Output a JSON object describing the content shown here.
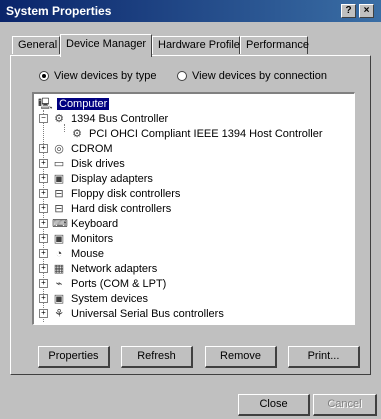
{
  "window": {
    "title": "System Properties",
    "help_button": "?",
    "close_button": "×"
  },
  "tabs": [
    {
      "label": "General"
    },
    {
      "label": "Device Manager"
    },
    {
      "label": "Hardware Profiles"
    },
    {
      "label": "Performance"
    }
  ],
  "view_options": {
    "by_type": "View devices by type",
    "by_connection": "View devices by connection",
    "selected": "by_type"
  },
  "tree": {
    "root": "Computer",
    "items": [
      {
        "label": "1394 Bus Controller",
        "expander": "−",
        "icon": "bus-controller-icon"
      },
      {
        "label": "PCI OHCI Compliant IEEE 1394 Host Controller",
        "expander": "",
        "icon": "bus-controller-icon"
      },
      {
        "label": "CDROM",
        "expander": "+",
        "icon": "cdrom-icon"
      },
      {
        "label": "Disk drives",
        "expander": "+",
        "icon": "disk-drive-icon"
      },
      {
        "label": "Display adapters",
        "expander": "+",
        "icon": "display-adapter-icon"
      },
      {
        "label": "Floppy disk controllers",
        "expander": "+",
        "icon": "floppy-controller-icon"
      },
      {
        "label": "Hard disk controllers",
        "expander": "+",
        "icon": "hard-disk-controller-icon"
      },
      {
        "label": "Keyboard",
        "expander": "+",
        "icon": "keyboard-icon"
      },
      {
        "label": "Monitors",
        "expander": "+",
        "icon": "monitor-icon"
      },
      {
        "label": "Mouse",
        "expander": "+",
        "icon": "mouse-icon"
      },
      {
        "label": "Network adapters",
        "expander": "+",
        "icon": "network-adapter-icon"
      },
      {
        "label": "Ports (COM & LPT)",
        "expander": "+",
        "icon": "port-icon"
      },
      {
        "label": "System devices",
        "expander": "+",
        "icon": "system-device-icon"
      },
      {
        "label": "Universal Serial Bus controllers",
        "expander": "+",
        "icon": "usb-icon"
      }
    ]
  },
  "buttons": {
    "properties": "Properties",
    "refresh": "Refresh",
    "remove": "Remove",
    "print": "Print...",
    "close": "Close",
    "cancel": "Cancel"
  }
}
